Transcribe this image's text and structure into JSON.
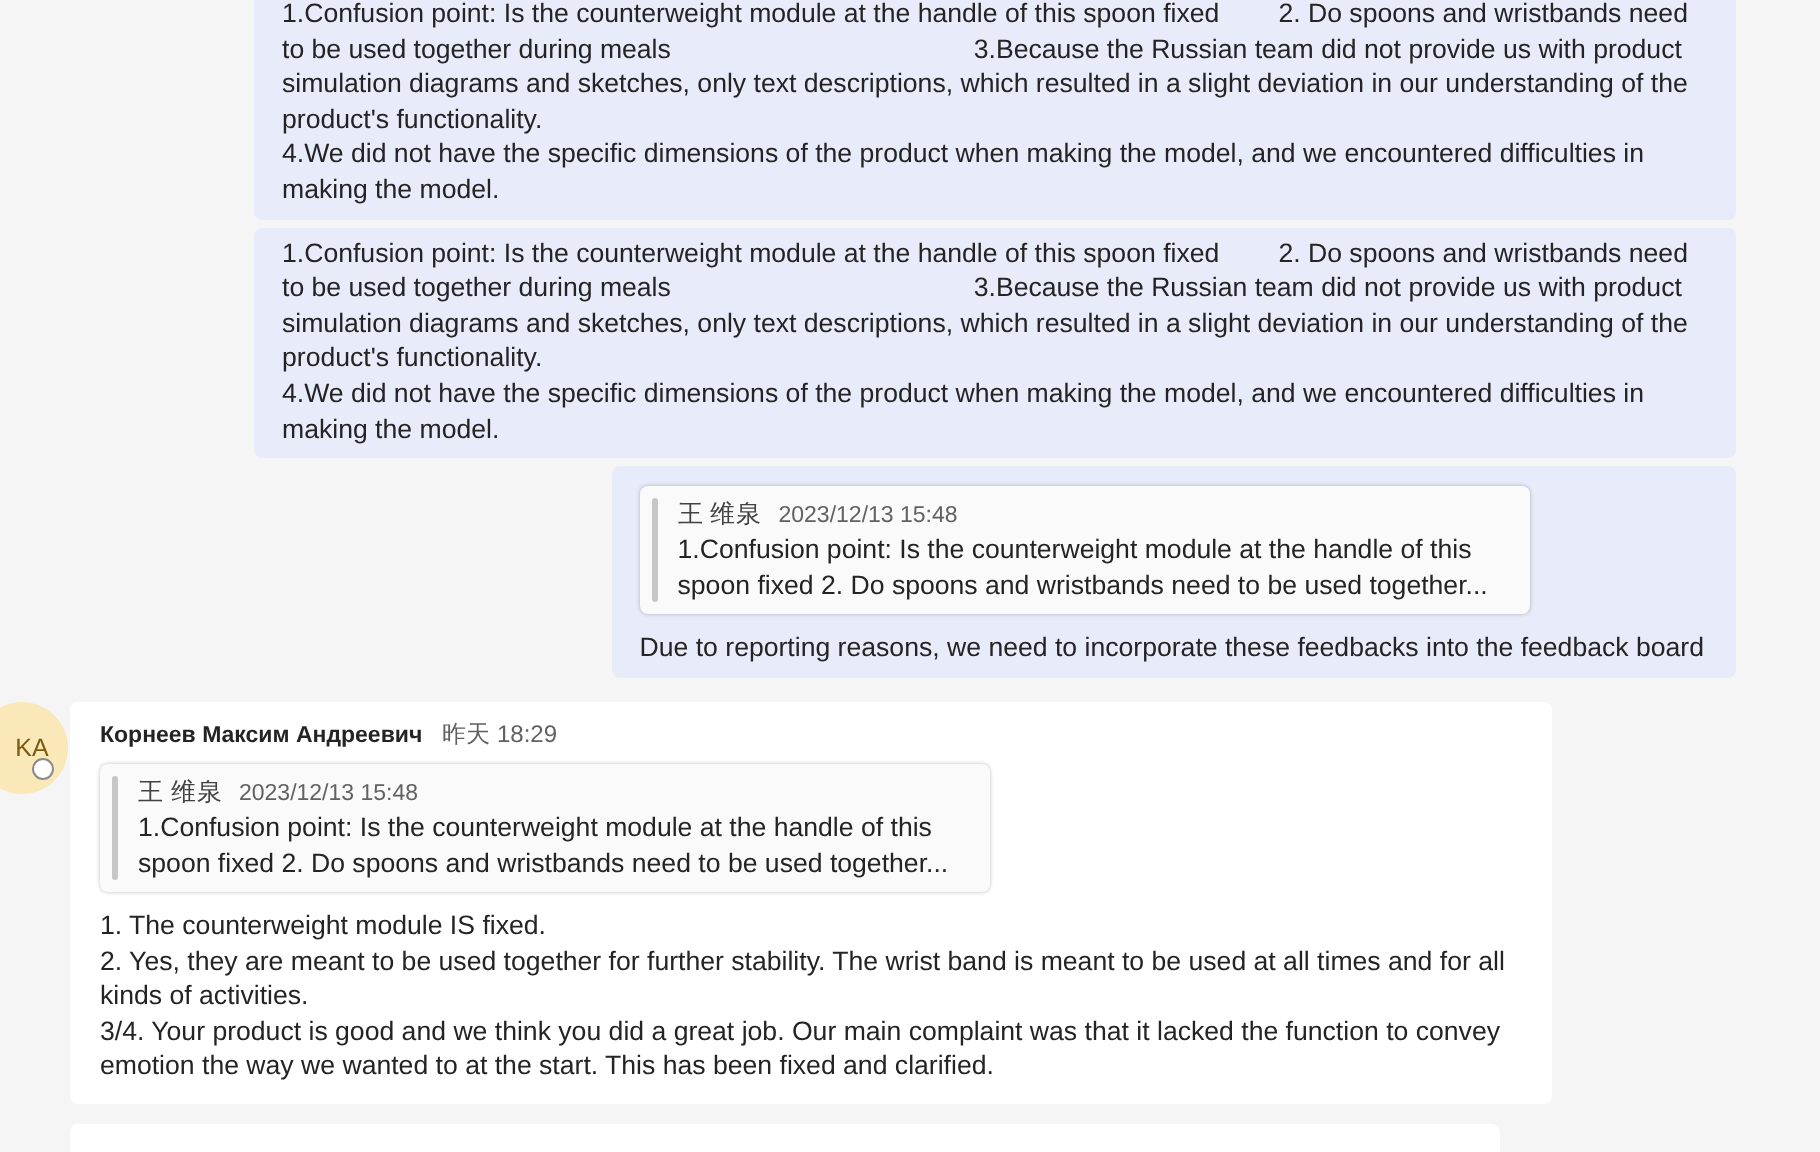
{
  "messages": [
    {
      "kind": "sent",
      "paragraphs": [
        "1.Confusion point: Is the counterweight module at the handle of this spoon fixed        2. Do spoons and wristbands need to be used together during meals                                         3.Because the Russian team did not provide us with product simulation diagrams and sketches, only text descriptions, which resulted in a slight deviation in our understanding of the product's functionality.",
        "4.We did not have the specific dimensions of the product when making the model, and we encountered difficulties in making the model."
      ]
    },
    {
      "kind": "sent",
      "paragraphs": [
        "1.Confusion point: Is the counterweight module at the handle of this spoon fixed        2. Do spoons and wristbands need to be used together during meals                                         3.Because the Russian team did not provide us with product simulation diagrams and sketches, only text descriptions, which resulted in a slight deviation in our understanding of the product's functionality.",
        "4.We did not have the specific dimensions of the product when making the model, and we encountered difficulties in making the model."
      ]
    },
    {
      "kind": "sent",
      "quote": {
        "author": "王 维泉",
        "time": "2023/12/13 15:48",
        "text": "1.Confusion point: Is the counterweight module at the handle of this spoon fixed 2. Do spoons and wristbands need to be used together..."
      },
      "paragraphs": [
        "Due to reporting reasons, we need to incorporate these feedbacks into the feedback board"
      ]
    },
    {
      "kind": "received",
      "avatar": "KA",
      "sender": "Корнеев Максим Андреевич",
      "time": "昨天 18:29",
      "quote": {
        "author": "王 维泉",
        "time": "2023/12/13 15:48",
        "text": "1.Confusion point: Is the counterweight module at the handle of this spoon fixed 2. Do spoons and wristbands need to be used together..."
      },
      "paragraphs": [
        "1. The counterweight module IS fixed.",
        "2. Yes, they are meant to be used together for further stability. The wrist band is meant to be used at all times and for all kinds of activities.",
        "3/4. Your product is good and we think you did a great job. Our main complaint was that it lacked the function to convey emotion the way we wanted to at the start. This has been fixed and clarified."
      ]
    },
    {
      "kind": "received_cut"
    }
  ]
}
